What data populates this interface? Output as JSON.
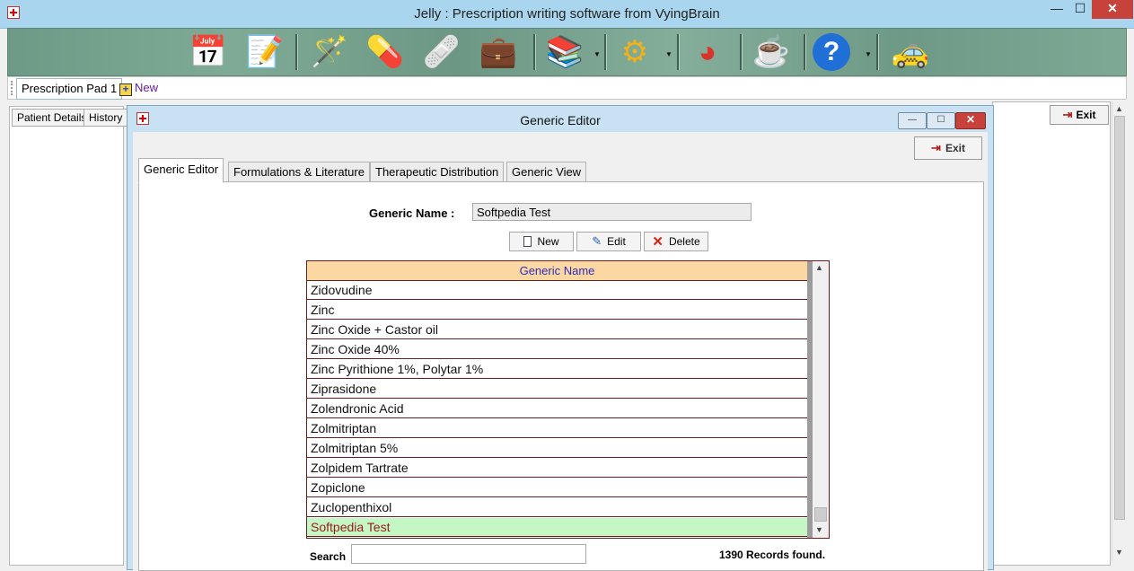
{
  "window": {
    "title": "Jelly : Prescription writing software from VyingBrain"
  },
  "toolbar": {
    "icons": [
      "appointments-icon",
      "notepad-icon",
      "wizard-icon",
      "pills-icon",
      "first-aid-icon",
      "medical-bag-icon",
      "books-icon",
      "settings-gear-icon",
      "pie-chart-icon",
      "coffee-cup-icon",
      "help-icon",
      "taxi-icon"
    ],
    "glyphs": {
      "appointments": "📅",
      "notepad": "📝",
      "wizard": "🪄",
      "pills": "💊",
      "first_aid": "🩹",
      "medical_bag": "💼",
      "books": "📚",
      "settings": "⚙",
      "pie_chart": "◕",
      "coffee": "☕",
      "help": "?",
      "taxi": "🚕"
    }
  },
  "tabs": {
    "pad": "Prescription Pad 1",
    "new": "New"
  },
  "left_panel": {
    "tabs": [
      "Patient Details",
      "History"
    ]
  },
  "main_exit": "Exit",
  "dialog": {
    "title": "Generic Editor",
    "exit": "Exit",
    "tabs": [
      "Generic Editor",
      "Formulations & Literature",
      "Therapeutic Distribution",
      "Generic View"
    ],
    "generic_name_label": "Generic Name :",
    "generic_name_value": "Softpedia Test",
    "buttons": {
      "new": "New",
      "edit": "Edit",
      "delete": "Delete"
    },
    "grid": {
      "header": "Generic Name",
      "rows": [
        "Zidovudine",
        "Zinc",
        "Zinc Oxide + Castor oil",
        "Zinc Oxide 40%",
        "Zinc Pyrithione 1%, Polytar 1%",
        "Ziprasidone",
        "Zolendronic Acid",
        "Zolmitriptan",
        "Zolmitriptan 5%",
        "Zolpidem Tartrate",
        "Zopiclone",
        "Zuclopenthixol",
        "Softpedia Test"
      ],
      "selected_index": 12
    },
    "search_label": "Search",
    "search_value": "",
    "records": "1390 Records found."
  },
  "colors": {
    "grid_header": "#fbd7a2",
    "grid_border": "#6b1d1d",
    "selected_row": "#c4f7c4",
    "title_bar": "#a9d6ee"
  }
}
